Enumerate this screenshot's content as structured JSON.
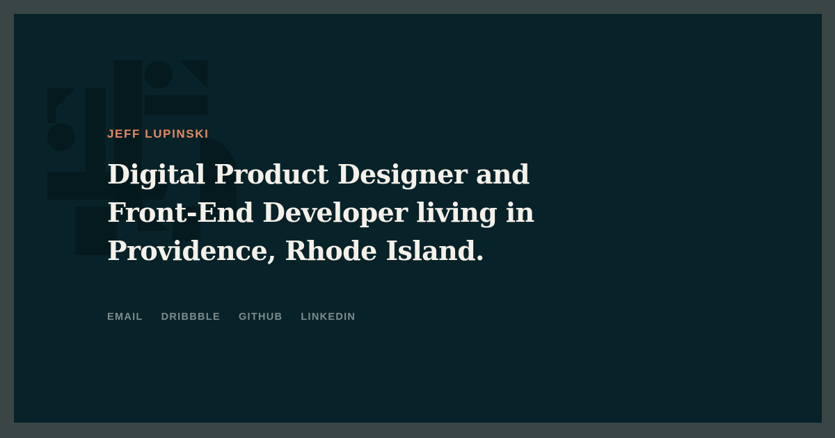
{
  "header": {
    "name": "JEFF LUPINSKI"
  },
  "hero": {
    "headline": "Digital Product Designer and Front-End Developer living in Providence, Rhode Island."
  },
  "links": [
    {
      "label": "EMAIL"
    },
    {
      "label": "DRIBBBLE"
    },
    {
      "label": "GITHUB"
    },
    {
      "label": "LINKEDIN"
    }
  ],
  "colors": {
    "outer_background": "#3a4646",
    "panel_background": "#072228",
    "accent": "#e58a64",
    "headline_text": "#f4f1ea",
    "link_text": "#7d8c8e",
    "logo_shapes": "#041a1e"
  },
  "icons": {
    "logo_mark": "geometric-monogram-icon"
  }
}
